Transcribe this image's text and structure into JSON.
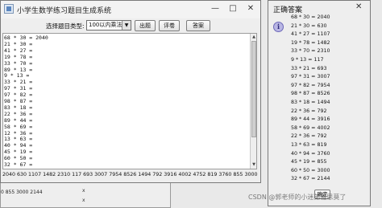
{
  "background_window": {
    "answers_tail": "0 855 3000 2144",
    "x_marks": [
      "x",
      "x",
      "x"
    ]
  },
  "main_window": {
    "title": "小学生数学练习题目生成系统",
    "controls": {
      "minimize": "—",
      "maximize": "□",
      "close": "✕"
    },
    "type_label": "选择题目类型:",
    "type_select": {
      "value": "100以内乘法"
    },
    "buttons": {
      "generate": "出题",
      "grade": "评卷",
      "answer": "答案"
    },
    "questions": [
      "68 * 30 = 2040",
      "21 * 30 =",
      "41 * 27 =",
      "19 * 78 =",
      "33 * 70 =",
      "89 * 13 =",
      "9 * 13 =",
      "33 * 21 =",
      "97 * 31 =",
      "97 * 82 =",
      "98 * 87 =",
      "83 * 18 =",
      "22 * 36 =",
      "89 * 44 =",
      "58 * 69 =",
      "12 * 36 =",
      "13 * 63 =",
      "40 * 94 =",
      "45 * 19 =",
      "60 * 50 =",
      "32 * 67 ="
    ],
    "answers_line": "2040 630 1107 1482 2310 117 693 3007 7954 8526 1494 792 3916 4002 4752 819 3760 855 3000 2144"
  },
  "dialog": {
    "title": "正确答案",
    "close": "✕",
    "info_icon": "i",
    "answers": [
      "68 * 30 = 2040",
      "21 * 30 = 630",
      "41 * 27 = 1107",
      "19 * 78 = 1482",
      "33 * 70 = 2310",
      "9 * 13 = 117",
      "33 * 21 = 693",
      "97 * 31 = 3007",
      "97 * 82 = 7954",
      "98 * 87 = 8526",
      "83 * 18 = 1494",
      "22 * 36 = 792",
      "89 * 44 = 3916",
      "58 * 69 = 4002",
      "22 * 36 = 792",
      "13 * 63 = 819",
      "40 * 94 = 3760",
      "45 * 19 = 855",
      "60 * 50 = 3000",
      "32 * 67 = 2144"
    ],
    "ok_label": "确定"
  },
  "watermark": "CSDN @郭老师的小迷弟雅思莫了",
  "colors": {
    "info_icon_bg": "#b9b6e4",
    "window_bg": "#eeeeee"
  }
}
